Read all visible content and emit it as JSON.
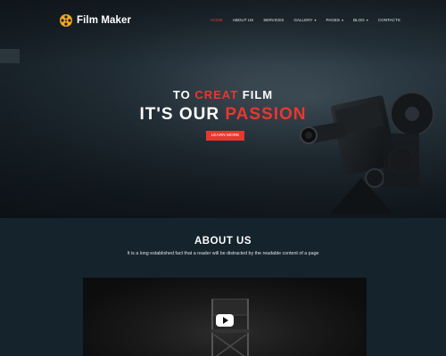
{
  "header": {
    "logo_text": "Film Maker",
    "nav": [
      {
        "label": "HOME",
        "active": true,
        "dropdown": false
      },
      {
        "label": "ABOUT US",
        "active": false,
        "dropdown": false
      },
      {
        "label": "SERVICES",
        "active": false,
        "dropdown": false
      },
      {
        "label": "GALLERY",
        "active": false,
        "dropdown": true
      },
      {
        "label": "PAGES",
        "active": false,
        "dropdown": true
      },
      {
        "label": "BLOG",
        "active": false,
        "dropdown": true
      },
      {
        "label": "CONTACTS",
        "active": false,
        "dropdown": false
      }
    ]
  },
  "hero": {
    "line1_pre": "TO ",
    "line1_accent": "CREAT",
    "line1_post": " FILM",
    "line2_pre": "IT'S OUR ",
    "line2_accent": "PASSION",
    "button_label": "LEARN MORE"
  },
  "about": {
    "title": "ABOUT US",
    "text": "It is a long established fact that a reader will be distracted by the readable content of a page"
  },
  "colors": {
    "accent": "#e8372f",
    "background": "#15232c"
  },
  "icons": [
    "film-reel-icon",
    "chevron-down-icon",
    "play-icon"
  ]
}
